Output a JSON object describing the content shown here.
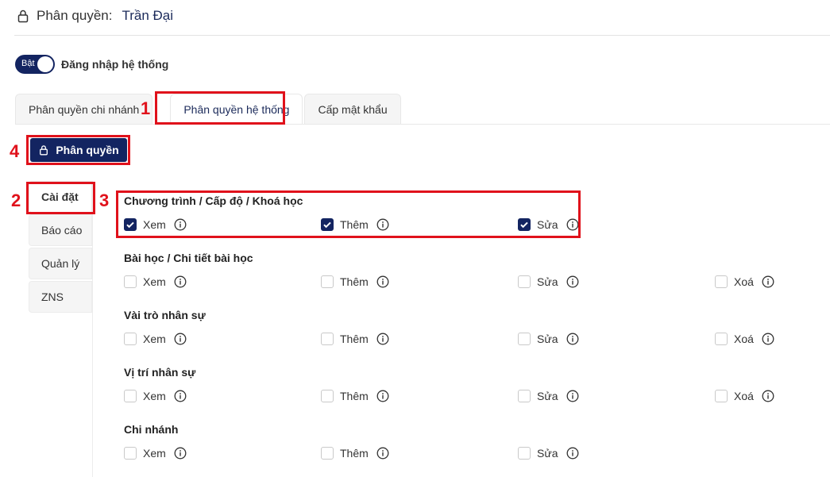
{
  "header": {
    "title_label": "Phân quyền:",
    "title_name": "Trần Đại"
  },
  "toggle": {
    "state_text": "Bật",
    "label": "Đăng nhập hệ thống"
  },
  "tabs": [
    {
      "label": "Phân quyền chi nhánh"
    },
    {
      "label": "Phân quyền hệ thống"
    },
    {
      "label": "Cấp mật khẩu"
    }
  ],
  "action_button": {
    "label": "Phân quyền"
  },
  "sidebar": {
    "items": [
      {
        "label": "Cài đặt"
      },
      {
        "label": "Báo cáo"
      },
      {
        "label": "Quản lý"
      },
      {
        "label": "ZNS"
      }
    ]
  },
  "groups": [
    {
      "title": "Chương trình / Cấp độ / Khoá học",
      "perms": [
        {
          "label": "Xem",
          "checked": true
        },
        {
          "label": "Thêm",
          "checked": true
        },
        {
          "label": "Sửa",
          "checked": true
        }
      ]
    },
    {
      "title": "Bài học / Chi tiết bài học",
      "perms": [
        {
          "label": "Xem",
          "checked": false
        },
        {
          "label": "Thêm",
          "checked": false
        },
        {
          "label": "Sửa",
          "checked": false
        },
        {
          "label": "Xoá",
          "checked": false
        }
      ]
    },
    {
      "title": "Vài trò nhân sự",
      "perms": [
        {
          "label": "Xem",
          "checked": false
        },
        {
          "label": "Thêm",
          "checked": false
        },
        {
          "label": "Sửa",
          "checked": false
        },
        {
          "label": "Xoá",
          "checked": false
        }
      ]
    },
    {
      "title": "Vị trí nhân sự",
      "perms": [
        {
          "label": "Xem",
          "checked": false
        },
        {
          "label": "Thêm",
          "checked": false
        },
        {
          "label": "Sửa",
          "checked": false
        },
        {
          "label": "Xoá",
          "checked": false
        }
      ]
    },
    {
      "title": "Chi nhánh",
      "perms": [
        {
          "label": "Xem",
          "checked": false
        },
        {
          "label": "Thêm",
          "checked": false
        },
        {
          "label": "Sửa",
          "checked": false
        }
      ]
    }
  ],
  "annotations": {
    "m1": "1",
    "m2": "2",
    "m3": "3",
    "m4": "4"
  },
  "colors": {
    "primary": "#132461",
    "highlight": "#e0111b"
  }
}
